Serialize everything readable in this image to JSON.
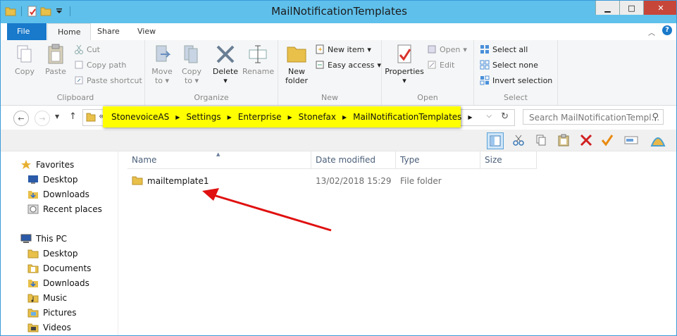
{
  "window": {
    "title": "MailNotificationTemplates"
  },
  "window_controls": {
    "minimize": "▁",
    "maximize": "□",
    "close": "✕"
  },
  "tabs": [
    {
      "label": "File"
    },
    {
      "label": "Home"
    },
    {
      "label": "Share"
    },
    {
      "label": "View"
    }
  ],
  "help_label": "?",
  "ribbon": {
    "clipboard": {
      "label": "Clipboard",
      "copy": "Copy",
      "paste": "Paste",
      "cut": "Cut",
      "copy_path": "Copy path",
      "paste_shortcut": "Paste shortcut"
    },
    "organize": {
      "label": "Organize",
      "move_to": "Move to",
      "copy_to": "Copy to",
      "delete": "Delete",
      "rename": "Rename"
    },
    "new": {
      "label": "New",
      "new_folder": "New folder",
      "new_item": "New item",
      "easy_access": "Easy access"
    },
    "open": {
      "label": "Open",
      "properties": "Properties",
      "open": "Open",
      "edit": "Edit"
    },
    "select": {
      "label": "Select",
      "select_all": "Select all",
      "select_none": "Select none",
      "invert_selection": "Invert selection"
    }
  },
  "address": {
    "overflow": "«",
    "breadcrumbs": [
      "StonevoiceAS",
      "Settings",
      "Enterprise",
      "Stonefax",
      "MailNotificationTemplates"
    ]
  },
  "search": {
    "placeholder": "Search MailNotificationTempl..."
  },
  "navpane": {
    "favorites": {
      "label": "Favorites",
      "items": [
        "Desktop",
        "Downloads",
        "Recent places"
      ]
    },
    "this_pc": {
      "label": "This PC",
      "items": [
        "Desktop",
        "Documents",
        "Downloads",
        "Music",
        "Pictures",
        "Videos"
      ]
    }
  },
  "columns": [
    "Name",
    "Date modified",
    "Type",
    "Size"
  ],
  "files": [
    {
      "name": "mailtemplate1",
      "date_modified": "13/02/2018 15:29",
      "type": "File folder",
      "size": ""
    }
  ],
  "colors": {
    "titlebar": "#5fc0eb",
    "file_tab": "#1979ca",
    "highlight": "#ffff00",
    "arrow": "#e01010"
  }
}
